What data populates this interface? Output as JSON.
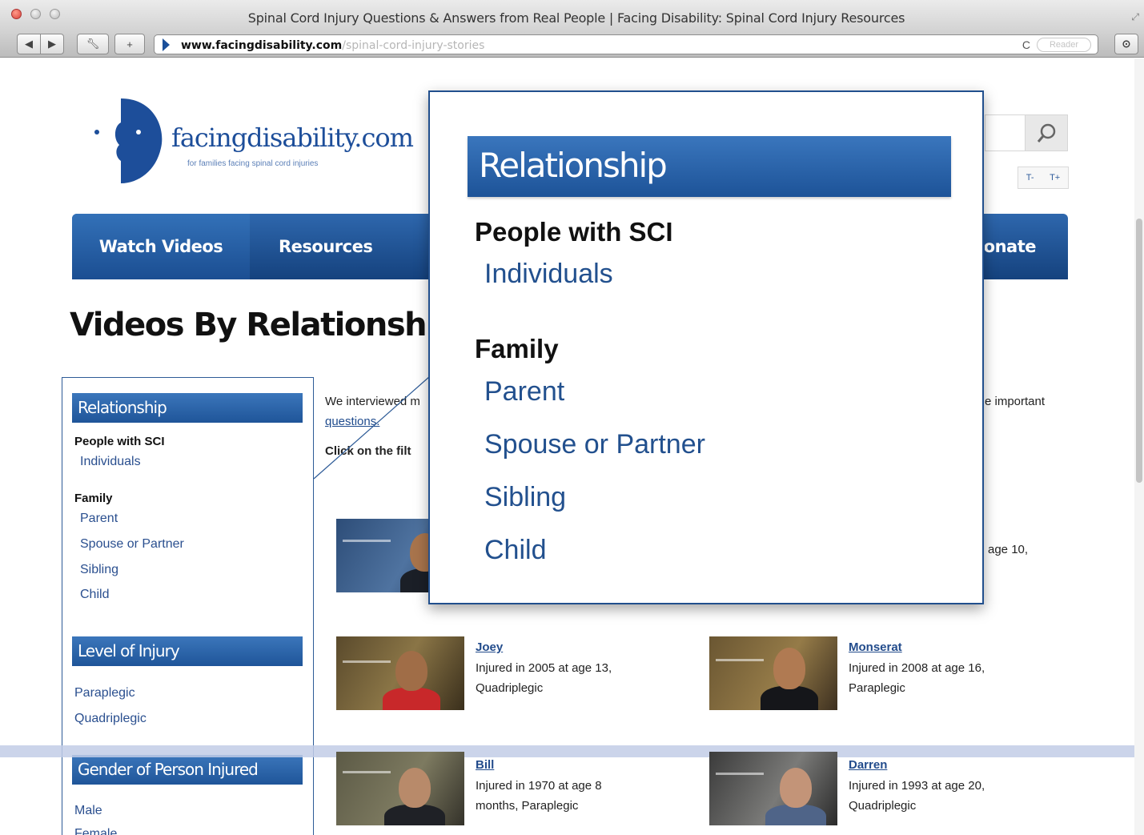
{
  "browser": {
    "window_title": "Spinal Cord Injury Questions & Answers from Real People | Facing Disability: Spinal Cord Injury Resources",
    "url_host": "www.facingdisability.com",
    "url_path": "/spinal-cord-injury-stories",
    "reader_label": "Reader"
  },
  "site": {
    "logo_text": "facingdisability.com",
    "logo_tagline": "for families facing spinal cord injuries",
    "font_small": "T-",
    "font_large": "T+"
  },
  "nav": {
    "items": [
      "Watch Videos",
      "Resources",
      "Donate"
    ]
  },
  "page": {
    "title": "Videos By Relationship",
    "intro_start": "We interviewed m",
    "intro_end": "e important",
    "intro_link": "questions.",
    "filter_hint": "Click on the filt",
    "age_fragment": "age 10,"
  },
  "sidebar": {
    "relationship_heading": "Relationship",
    "people_group": "People with SCI",
    "people_links": [
      "Individuals"
    ],
    "family_group": "Family",
    "family_links": [
      "Parent",
      "Spouse or Partner",
      "Sibling",
      "Child"
    ],
    "level_heading": "Level of Injury",
    "level_links": [
      "Paraplegic",
      "Quadriplegic"
    ],
    "gender_heading": "Gender of Person Injured",
    "gender_links": [
      "Male",
      "Female"
    ]
  },
  "videos": [
    {
      "name": "Joey",
      "line1": "Injured in 2005 at age 13,",
      "line2": "Quadriplegic"
    },
    {
      "name": "Monserat",
      "line1": "Injured in 2008 at age 16,",
      "line2": "Paraplegic"
    },
    {
      "name": "Bill",
      "line1": "Injured in 1970 at age 8",
      "line2": "months, Paraplegic"
    },
    {
      "name": "Darren",
      "line1": "Injured in 1993 at age 20,",
      "line2": "Quadriplegic"
    }
  ],
  "colors": {
    "brand_blue": "#1d4e9a",
    "nav_blue": "#15427e",
    "link_blue": "#2a4f8f"
  }
}
